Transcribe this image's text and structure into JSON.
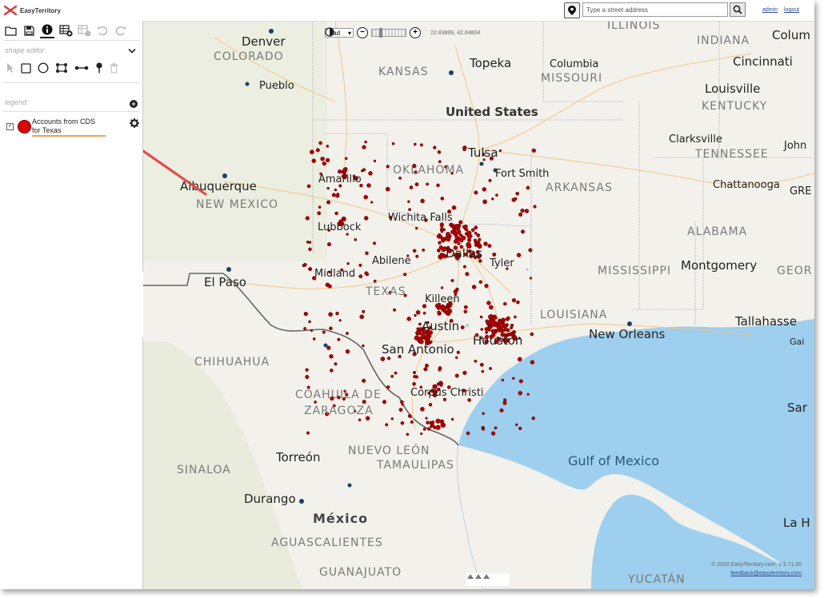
{
  "app": {
    "name": "EasyTerritory"
  },
  "header": {
    "address_placeholder": "Type a street address",
    "admin_label": "admin",
    "logout_label": "logout"
  },
  "panel": {
    "shape_editor_label": "shape editor:",
    "legend_label": "legend:",
    "legend_items": [
      {
        "label": "Accounts from CDS for Texas",
        "color": "#e00000",
        "checked": true
      }
    ],
    "tools": [
      "folder-icon",
      "save-icon",
      "info-icon",
      "table-add-icon",
      "table-remove-icon",
      "undo-icon",
      "redo-icon"
    ],
    "shape_tools": [
      "pointer-icon",
      "rectangle-icon",
      "circle-icon",
      "polygon-icon",
      "line-icon",
      "pin-icon",
      "trash-icon"
    ]
  },
  "map": {
    "layer_select": "road",
    "coordinates": "22.83899, 42.64804",
    "attribution": "© 2020 EasyTerritory.com, v 3.71.00",
    "feedback": "feedback@easyterritory.com",
    "labels": {
      "illinois": "ILLINOIS",
      "indiana": "INDIANA",
      "columbus": "Colum",
      "denver": "Denver",
      "colorado": "COLORADO",
      "topeka": "Topeka",
      "columbia": "Columbia",
      "cincinnati": "Cincinnati",
      "kansas": "KANSAS",
      "missouri": "MISSOURI",
      "louisville": "Louisville",
      "pueblo": "Pueblo",
      "kentucky": "KENTUCKY",
      "united_states": "United States",
      "clarksville": "Clarksville",
      "tulsa": "Tulsa",
      "john": "John",
      "tennessee": "TENNESSEE",
      "oklahoma": "OKLAHOMA",
      "fort_smith": "Fort Smith",
      "albuquerque": "Albuquerque",
      "amarillo": "Amarillo",
      "arkansas": "ARKANSAS",
      "chattanooga": "Chattanooga",
      "gre": "GRE",
      "new_mexico": "NEW MEXICO",
      "wichita_falls": "Wichita Falls",
      "lubbock": "Lubbock",
      "alabama": "ALABAMA",
      "dallas": "Dallas",
      "tyler": "Tyler",
      "abilene": "Abilene",
      "montgomery": "Montgomery",
      "midland": "Midland",
      "mississippi": "MISSISSIPPI",
      "geor": "GEOR",
      "el_paso": "El Paso",
      "texas": "TEXAS",
      "killeen": "Killeen",
      "louisiana": "LOUISIANA",
      "tallahassee": "Tallahasse",
      "austin": "Austin",
      "houston": "Houston",
      "new_orleans": "New Orleans",
      "gai": "Gai",
      "san_antonio": "San Antonio",
      "chihuahua": "CHIHUAHUA",
      "corpus_christi": "Corpus Christi",
      "coahuila": "COAHUILA DE",
      "zaragoza": "ZARAGOZA",
      "sar": "Sar",
      "torreon": "Torreón",
      "nuevo_leon": "NUEVO LEÓN",
      "tamaulipas": "TAMAULIPAS",
      "gulf_of_mexico": "Gulf of Mexico",
      "sinaloa": "SINALOA",
      "durango": "Durango",
      "mexico": "México",
      "la_h": "La H",
      "aguascalientes": "AGUASCALIENTES",
      "guanajuato": "GUANAJUATO",
      "yucatan": "YUCATÁN"
    }
  },
  "colors": {
    "accent": "#e00000",
    "water": "#9ecfee",
    "underline": "#f0a050"
  }
}
